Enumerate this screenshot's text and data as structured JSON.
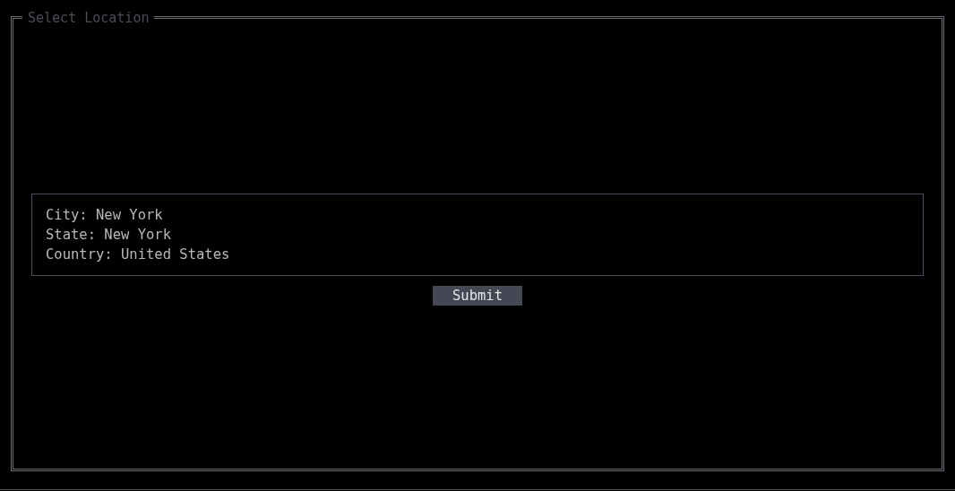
{
  "panel": {
    "title": "Select Location"
  },
  "details": [
    "City: New York",
    "State: New York",
    "Country: United States"
  ],
  "buttons": [
    "Submit"
  ]
}
